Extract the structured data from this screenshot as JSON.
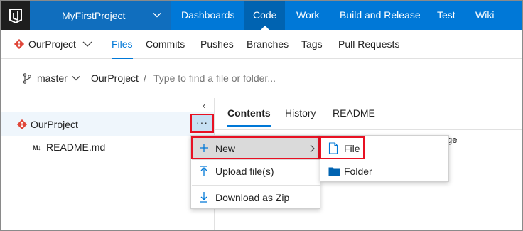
{
  "topnav": {
    "project": "MyFirstProject",
    "items": [
      "Dashboards",
      "Code",
      "Work",
      "Build and Release",
      "Test",
      "Wiki"
    ],
    "active": "Code"
  },
  "subnav": {
    "repo": "OurProject",
    "links": [
      "Files",
      "Commits",
      "Pushes",
      "Branches",
      "Tags",
      "Pull Requests"
    ],
    "active": "Files"
  },
  "pathbar": {
    "branch": "master",
    "root": "OurProject",
    "separator": "/",
    "placeholder": "Type to find a file or folder..."
  },
  "tree": {
    "collapse_glyph": "‹",
    "root": "OurProject",
    "more_glyph": "···",
    "items": [
      {
        "icon": "M↓",
        "label": "README.md"
      }
    ]
  },
  "content": {
    "tabs": [
      "Contents",
      "History",
      "README"
    ],
    "active": "Contents",
    "peek_text": "ge"
  },
  "context_menu": {
    "items": [
      {
        "label": "New",
        "icon": "plus-icon",
        "has_submenu": true
      },
      {
        "label": "Upload file(s)",
        "icon": "upload-icon"
      },
      {
        "label": "Download as Zip",
        "icon": "download-icon"
      }
    ]
  },
  "submenu": {
    "items": [
      {
        "label": "File",
        "icon": "file-icon"
      },
      {
        "label": "Folder",
        "icon": "folder-icon"
      }
    ]
  },
  "colors": {
    "brand": "#0078d7",
    "highlight_border": "#e81123",
    "git_orange": "#e0473a"
  }
}
